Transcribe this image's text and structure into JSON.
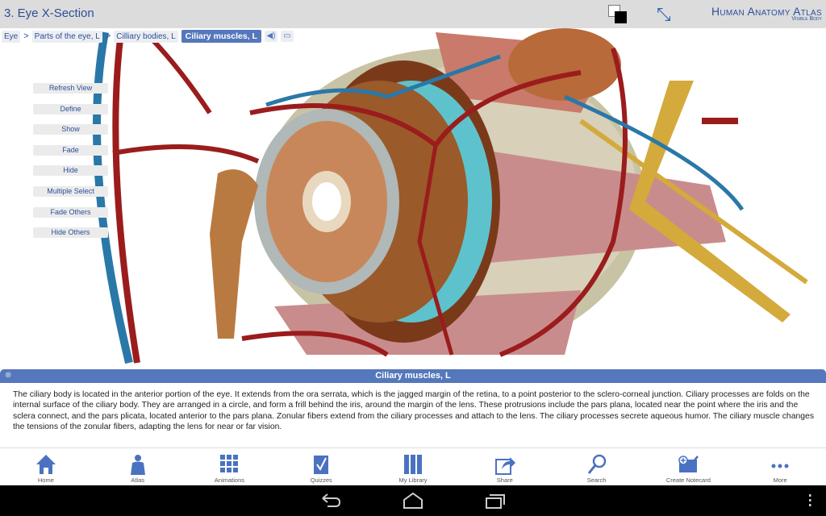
{
  "header": {
    "title": "3. Eye X-Section",
    "brand": "Human Anatomy Atlas",
    "brand_sub": "Visible Body"
  },
  "breadcrumb": {
    "items": [
      "Eye",
      "Parts of the eye, L",
      "Cilliary bodies, L"
    ],
    "active": "Ciliary muscles, L",
    "separator": ">"
  },
  "tools": [
    "Refresh View",
    "Define",
    "Show",
    "Fade",
    "Hide",
    "Multiple Select",
    "Fade Others",
    "Hide Others"
  ],
  "info": {
    "title": "Ciliary muscles, L",
    "text": "The ciliary body is located in the anterior portion of the eye. It extends from the ora serrata, which is the jagged margin of the retina, to a point posterior to the sclero-corneal junction. Ciliary processes are folds on the internal surface of the ciliary body. They are arranged in a circle, and form a frill behind the iris, around the margin of the lens. These protrusions include the pars plana, located near the point where the iris and the sclera connect, and the pars plicata, located anterior to the pars plana. Zonular fibers extend from the ciliary processes and attach to the lens. The ciliary processes secrete aqueous humor. The ciliary muscle changes the tensions of the zonular fibers, adapting the lens for near or far vision."
  },
  "nav": [
    "Home",
    "Atlas",
    "Animations",
    "Quizzes",
    "My Library",
    "Share",
    "Search",
    "Create Notecard",
    "More"
  ],
  "colors": {
    "accent": "#5577bb",
    "title": "#2c4f9a",
    "artery": "#9b1c1c",
    "vein": "#2a78a8"
  }
}
